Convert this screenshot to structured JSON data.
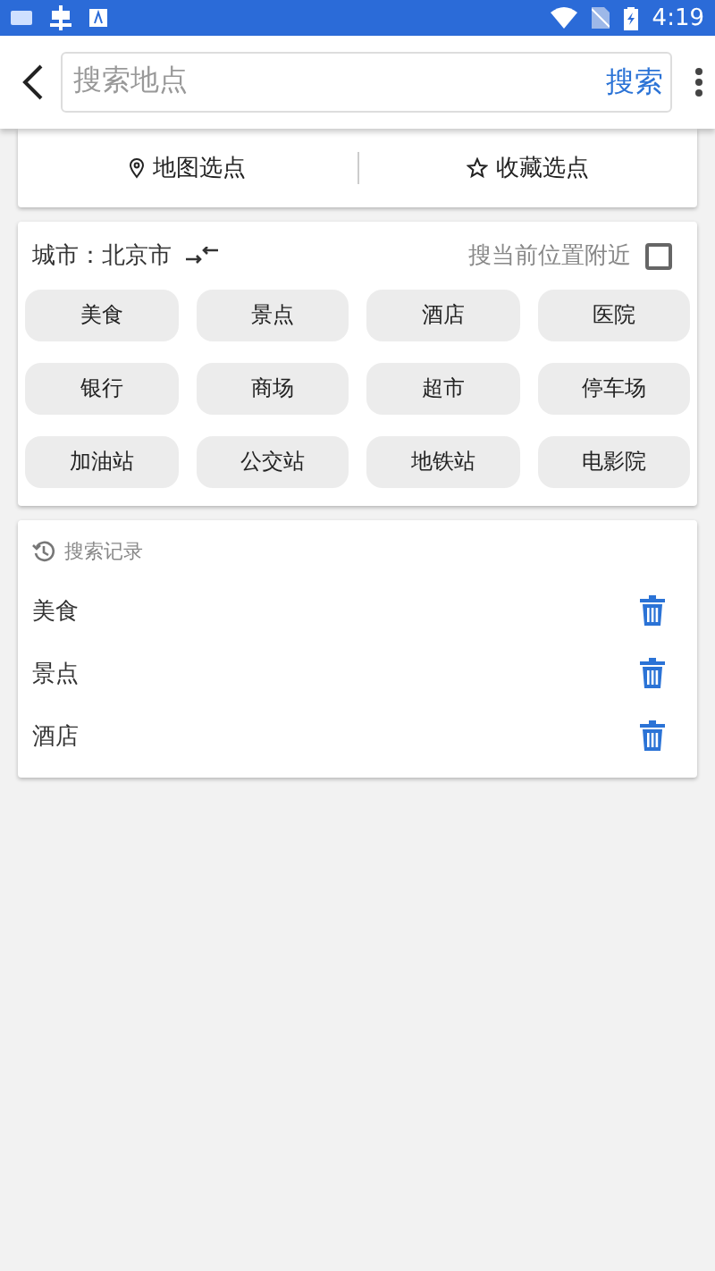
{
  "status_bar": {
    "time": "4:19"
  },
  "search": {
    "placeholder": "搜索地点",
    "button": "搜索"
  },
  "pick_tabs": [
    {
      "label": "地图选点",
      "kind": "map"
    },
    {
      "label": "收藏选点",
      "kind": "favorite"
    }
  ],
  "city": {
    "label": "城市：北京市",
    "nearby_label": "搜当前位置附近",
    "nearby_checked": false
  },
  "categories": [
    "美食",
    "景点",
    "酒店",
    "医院",
    "银行",
    "商场",
    "超市",
    "停车场",
    "加油站",
    "公交站",
    "地铁站",
    "电影院"
  ],
  "history": {
    "title": "搜索记录",
    "items": [
      "美食",
      "景点",
      "酒店"
    ]
  }
}
